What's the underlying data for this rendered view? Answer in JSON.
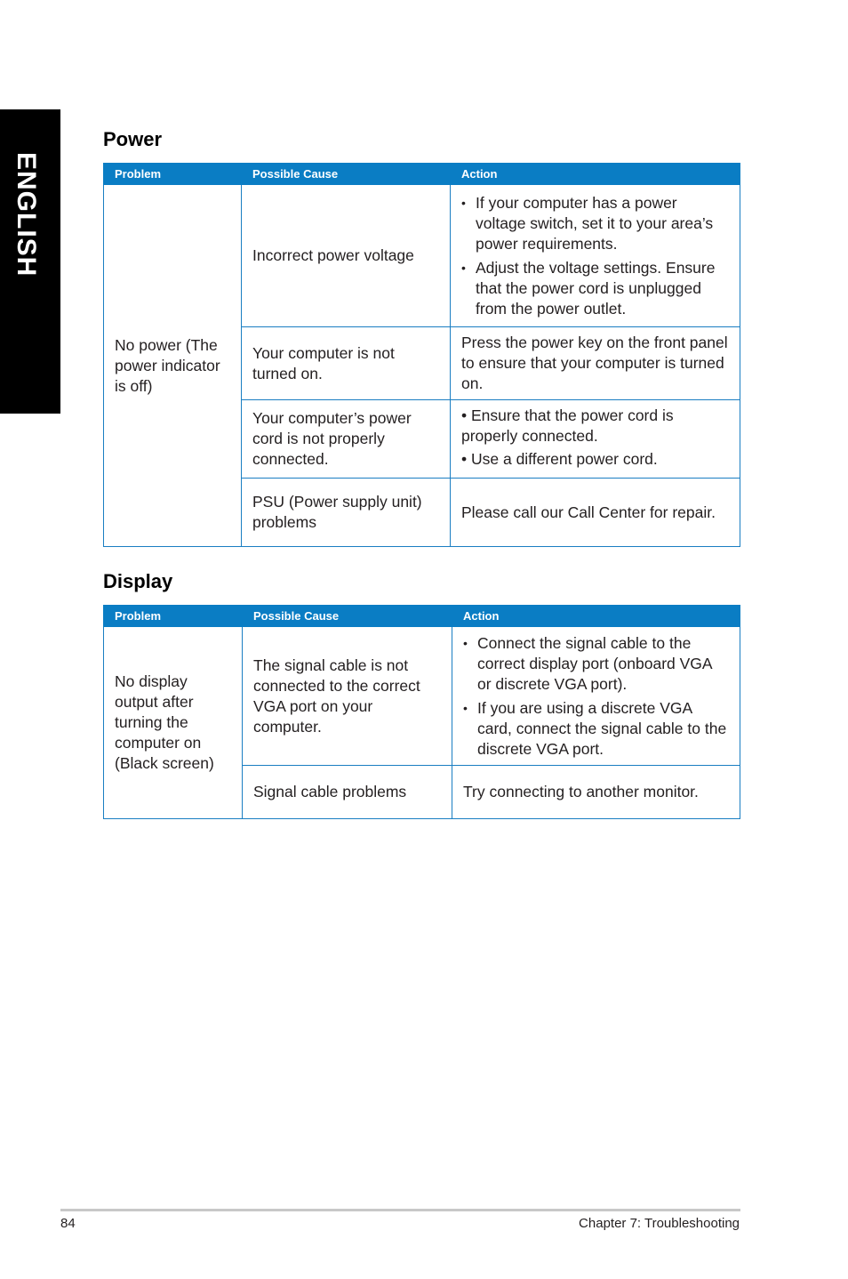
{
  "side_tab": {
    "label": "ENGLISH"
  },
  "power": {
    "title": "Power",
    "headers": {
      "problem": "Problem",
      "cause": "Possible Cause",
      "action": "Action"
    },
    "problem": "No power (The power indicator is off)",
    "rows": [
      {
        "cause": "Incorrect power voltage",
        "actions": [
          "If your computer has a power voltage switch, set it to your area’s power requirements.",
          "Adjust the voltage settings. Ensure that the power cord is unplugged from the power outlet."
        ]
      },
      {
        "cause": "Your computer is not turned on.",
        "action": "Press the power key on the front panel to ensure that your computer is turned on."
      },
      {
        "cause": "Your computer’s power cord is not properly connected.",
        "actions": [
          "• Ensure that the power cord is properly connected.",
          "• Use a different power cord."
        ]
      },
      {
        "cause": "PSU (Power supply unit) problems",
        "action": "Please call our Call Center for repair."
      }
    ]
  },
  "display": {
    "title": "Display",
    "headers": {
      "problem": "Problem",
      "cause": "Possible Cause",
      "action": "Action"
    },
    "problem": "No display output after turning the computer on (Black screen)",
    "rows": [
      {
        "cause": "The signal cable is not connected to the correct VGA port on your computer.",
        "actions": [
          "Connect the signal cable to the correct display port (onboard VGA or discrete VGA port).",
          "If you are using a discrete VGA card, connect the signal cable to the discrete VGA port."
        ]
      },
      {
        "cause": "Signal cable problems",
        "action": "Try connecting to another monitor."
      }
    ]
  },
  "footer": {
    "page_number": "84",
    "chapter": "Chapter 7: Troubleshooting"
  }
}
